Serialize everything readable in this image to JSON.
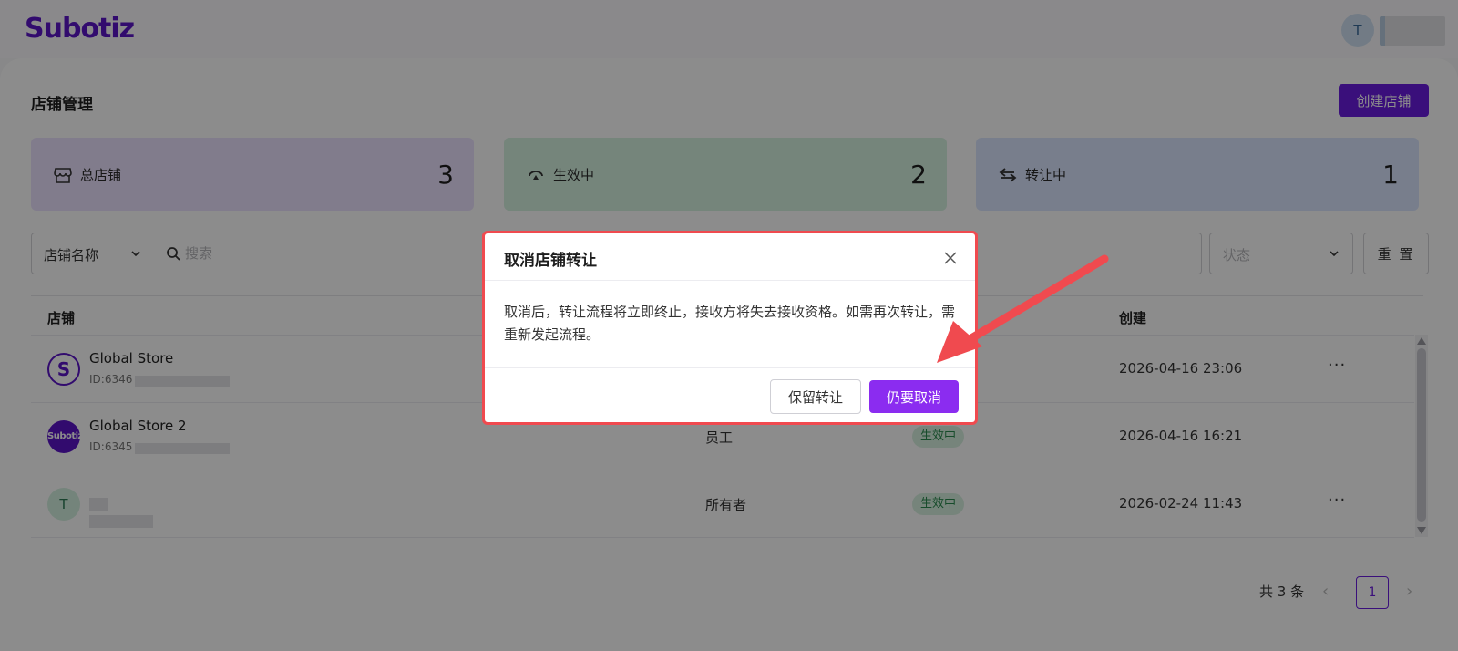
{
  "header": {
    "logo": "Subotiz",
    "user_avatar": "T"
  },
  "page": {
    "title": "店铺管理",
    "create_button": "创建店铺"
  },
  "stats": [
    {
      "label": "总店铺",
      "value": "3",
      "icon": "store-icon"
    },
    {
      "label": "生效中",
      "value": "2",
      "icon": "active-loop-icon"
    },
    {
      "label": "转让中",
      "value": "1",
      "icon": "transfer-arrows-icon"
    }
  ],
  "filters": {
    "field_select": "店铺名称",
    "search_placeholder": "搜索",
    "status_placeholder": "状态",
    "reset_button": "重 置"
  },
  "table": {
    "columns": [
      "店铺",
      "创建"
    ],
    "rows": [
      {
        "avatar": "S",
        "name": "Global Store",
        "id": "ID:6346",
        "role": "",
        "status": "",
        "created": "2026-04-16 23:06",
        "more": "···"
      },
      {
        "avatar": "Subotiz",
        "name": "Global Store 2",
        "id": "ID:6345",
        "role": "员工",
        "status": "生效中",
        "created": "2026-04-16 16:21",
        "more": "···"
      },
      {
        "avatar": "T",
        "name": "",
        "id": "",
        "role": "所有者",
        "status": "生效中",
        "created": "2026-02-24 11:43",
        "more": "···"
      }
    ]
  },
  "pagination": {
    "total": "共 3 条",
    "current_page": "1",
    "prev": "‹",
    "next": "›"
  },
  "modal": {
    "title": "取消店铺转让",
    "body": "取消后，转让流程将立即终止，接收方将失去接收资格。如需再次转让，需重新发起流程。",
    "keep_button": "保留转让",
    "confirm_button": "仍要取消"
  },
  "colors": {
    "brand": "#6b1de0",
    "confirm": "#8b2cf0",
    "highlight_border": "#f04a4f",
    "annotation_arrow": "#f04a4f"
  }
}
